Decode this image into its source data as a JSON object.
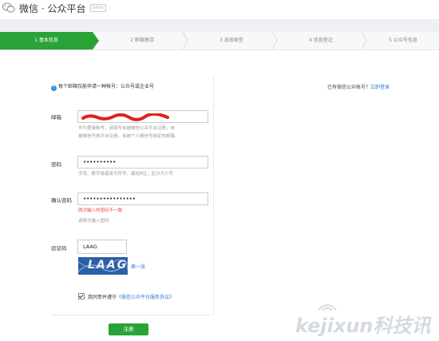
{
  "header": {
    "brand": "微信 · 公众平台",
    "beta": "beta"
  },
  "steps": [
    {
      "label": "1 基本信息",
      "active": true
    },
    {
      "label": "2 邮箱激活",
      "active": false
    },
    {
      "label": "3 选择类型",
      "active": false
    },
    {
      "label": "4 信息登记",
      "active": false
    },
    {
      "label": "5 公众号信息",
      "active": false
    }
  ],
  "notice": "每个邮箱仅能申请一种帐号：公众号或企业号",
  "right": {
    "text": "已有微信公众帐号？",
    "link": "立即登录"
  },
  "form": {
    "email": {
      "label": "邮箱",
      "hint1": "作为登录帐号，请填写未被微信公众平台注册，未",
      "hint2": "被微信开放平台注册，未被个人微信号绑定的邮箱"
    },
    "password": {
      "label": "密码",
      "value": "••••••••••",
      "hint": "字母、数字或者英文符号，最短8位，区分大小写"
    },
    "confirm": {
      "label": "确认密码",
      "value": "••••••••••••••••",
      "error": "两次输入的密码不一致",
      "hint": "请再次输入密码"
    },
    "captcha": {
      "label": "验证码",
      "value": "LAAG",
      "image_text": "LAAG",
      "refresh": "换一张"
    },
    "agree": {
      "prefix": "我同意并遵守",
      "link": "《微信公众平台服务协议》"
    },
    "submit": "注册"
  },
  "watermark": "kejixun科技讯",
  "colors": {
    "green": "#2aa336",
    "link": "#2e7bd6",
    "error": "#e44444",
    "captcha_bg": "#2c5fa6"
  }
}
